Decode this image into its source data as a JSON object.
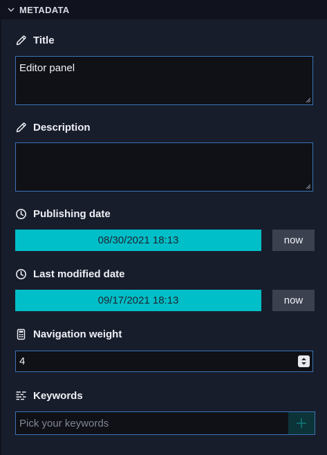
{
  "section": {
    "title": "METADATA",
    "icon": "chevron-down-icon"
  },
  "fields": {
    "title": {
      "label": "Title",
      "icon": "pencil-icon",
      "value": "Editor panel"
    },
    "description": {
      "label": "Description",
      "icon": "pencil-icon",
      "value": ""
    },
    "publishing_date": {
      "label": "Publishing date",
      "icon": "clock-icon",
      "value": "08/30/2021 18:13",
      "button": "now"
    },
    "last_modified_date": {
      "label": "Last modified date",
      "icon": "clock-icon",
      "value": "09/17/2021 18:13",
      "button": "now"
    },
    "navigation_weight": {
      "label": "Navigation weight",
      "icon": "calculator-icon",
      "value": "4"
    },
    "keywords": {
      "label": "Keywords",
      "icon": "list-icon",
      "placeholder": "Pick your keywords",
      "add_icon": "plus-icon"
    }
  },
  "colors": {
    "background": "#181d2c",
    "header": "#10131d",
    "input_bg": "#0f1117",
    "input_border": "#3b74b8",
    "date_bg": "#00bfc8",
    "button_bg": "#3c4150",
    "add_button_bg": "#0c3438"
  }
}
